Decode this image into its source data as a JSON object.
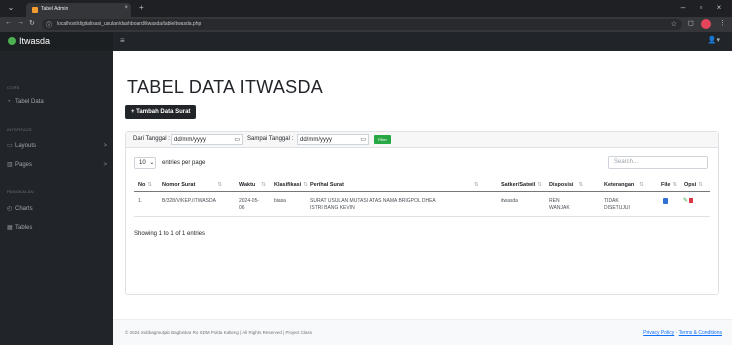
{
  "browser": {
    "tab_title": "Tabel Admin",
    "url": "localhost/digitalisasi_usulan/dashboard/itwasda/tableItwasda.php"
  },
  "navbar": {
    "brand": "Itwasda",
    "toggle_icon": "bars-icon",
    "user_icon": "user-icon"
  },
  "sidebar": {
    "headings": [
      "CORE",
      "INTERFACE",
      "PANGKALAN"
    ],
    "items": [
      {
        "label": "Tabel Data",
        "icon": "gauge-icon"
      },
      {
        "label": "Layouts",
        "icon": "columns-icon",
        "caret": ">"
      },
      {
        "label": "Pages",
        "icon": "book-icon",
        "caret": ">"
      },
      {
        "label": "Charts",
        "icon": "chart-icon"
      },
      {
        "label": "Tables",
        "icon": "table-icon"
      }
    ]
  },
  "main": {
    "title": "TABEL DATA ITWASDA",
    "add_button": "+ Tambah Data Surat"
  },
  "filter": {
    "from_label": "Dari Tanggal :",
    "from_value": "dd/mm/yyyy",
    "to_label": "Sampai Tanggal :",
    "to_value": "dd/mm/yyyy",
    "button": "Filter"
  },
  "datatable": {
    "entries_value": "10",
    "entries_label": "entries per page",
    "search_placeholder": "Search...",
    "columns": [
      "No",
      "Nomor Surat",
      "Waktu",
      "Klasifikasi",
      "Perihal Surat",
      "Satker/Satwil",
      "Disposisi",
      "Keterangan",
      "File",
      "Opsi"
    ],
    "rows": [
      {
        "no": "1.",
        "nomor_surat": "B/328/V/KEP./ITWASDA",
        "waktu_1": "2024-05-",
        "waktu_2": "06",
        "klasifikasi": "biasa",
        "perihal_1": "SURAT USULAN MUTASI ATAS NAMA BRIGPOL DHEA",
        "perihal_2": "ISTRI BANG KEVIN",
        "satker": "itwasda",
        "disposisi_1": "REN",
        "disposisi_2": "WANJAK",
        "keterangan_1": "TIDAK",
        "keterangan_2": "DISETUJUI"
      }
    ],
    "info": "Showing 1 to 1 of 1 entries"
  },
  "footer": {
    "copyright": "© 2024 Subbagmutjab Bagbinkar Ro SDM Polda Kalteng | All Rights Reserved | Project Class",
    "privacy": "Privacy Policy",
    "separator": " · ",
    "terms": "Terms & Conditions"
  },
  "colors": {
    "sidebar": "#212529",
    "primary_button": "#212529",
    "filter_button": "#28a745",
    "link": "#0d6efd"
  }
}
